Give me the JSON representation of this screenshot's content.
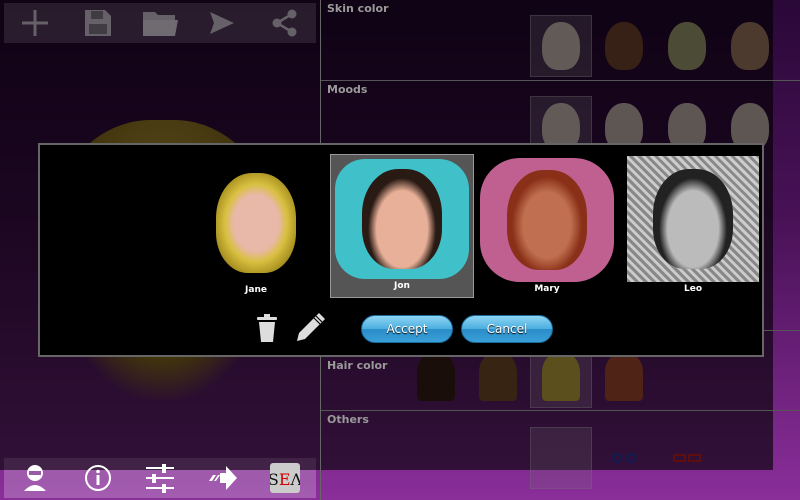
{
  "top_toolbar": [
    {
      "icon": "plus-icon"
    },
    {
      "icon": "save-icon"
    },
    {
      "icon": "folder-icon"
    },
    {
      "icon": "send-icon"
    },
    {
      "icon": "share-icon"
    }
  ],
  "bottom_toolbar": [
    {
      "icon": "user-icon"
    },
    {
      "icon": "info-icon"
    },
    {
      "icon": "sliders-icon"
    },
    {
      "icon": "forward-arrow-icon"
    },
    {
      "icon": "sea-logo-icon",
      "logo_text": "SEA"
    }
  ],
  "sections": {
    "skin_color": {
      "title": "Skin color"
    },
    "moods": {
      "title": "Moods"
    },
    "hair_color": {
      "title": "Hair color"
    },
    "others": {
      "title": "Others"
    }
  },
  "dialog": {
    "avatars": [
      {
        "name": "Jane"
      },
      {
        "name": "Jon"
      },
      {
        "name": "Mary"
      },
      {
        "name": "Leo"
      }
    ],
    "selected": "Jon",
    "accept_label": "Accept",
    "cancel_label": "Cancel"
  }
}
